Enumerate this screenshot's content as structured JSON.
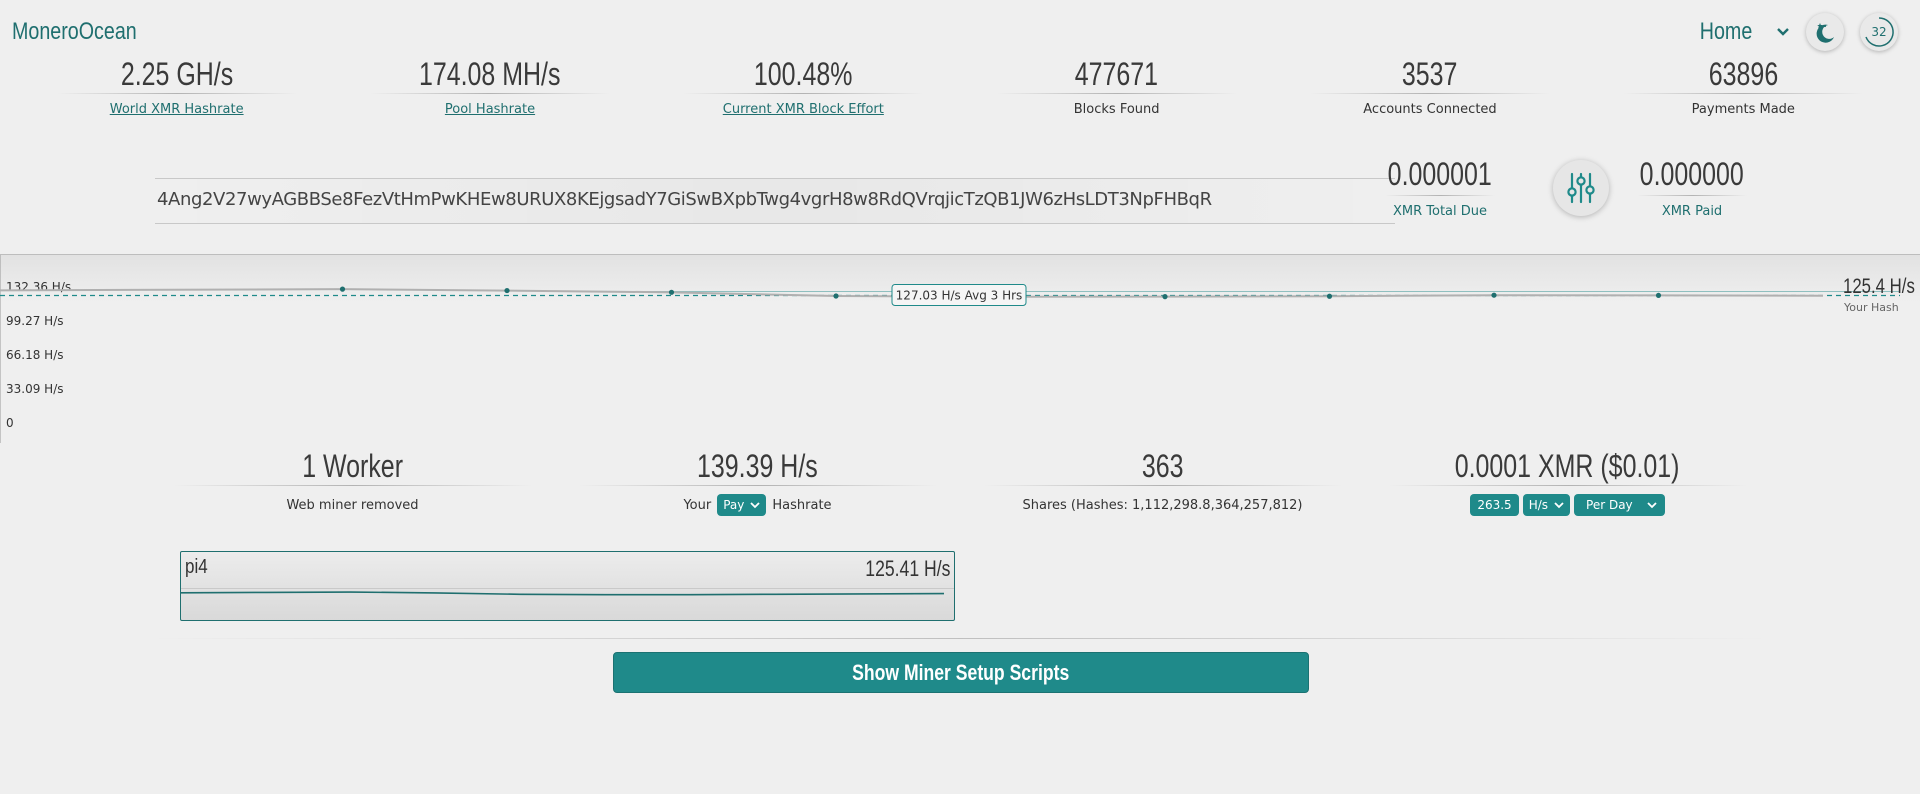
{
  "header": {
    "brand": "MoneroOcean",
    "nav_label": "Home",
    "counter": "32"
  },
  "stats": [
    {
      "value": "2.25 GH/s",
      "label": "World XMR Hashrate"
    },
    {
      "value": "174.08 MH/s",
      "label": "Pool Hashrate"
    },
    {
      "value": "100.48%",
      "label": "Current XMR Block Effort"
    },
    {
      "value": "477671",
      "label": "Blocks Found"
    },
    {
      "value": "3537",
      "label": "Accounts Connected"
    },
    {
      "value": "63896",
      "label": "Payments Made"
    }
  ],
  "account": {
    "address": "4Ang2V27wyAGBBSe8FezVtHmPwKHEw8URUX8KEjgsadY7GiSwBXpbTwg4vgrH8w8RdQVrqjicTzQB1JW6zHsLDT3NpFHBqR",
    "total_due": "0.000001",
    "total_due_label": "XMR Total Due",
    "paid": "0.000000",
    "paid_label": "XMR Paid"
  },
  "chart_data": {
    "type": "line",
    "y_ticks": [
      "132.36 H/s",
      "99.27 H/s",
      "66.18 H/s",
      "33.09 H/s",
      "0"
    ],
    "ylim": [
      0,
      132.36
    ],
    "values": [
      132,
      133.2,
      131.8,
      130.1,
      126.5,
      125.8,
      125.9,
      126.3,
      127.3,
      127.1,
      126.8
    ],
    "average_value": 127.03,
    "average_label": "127.03 H/s Avg 3 Hrs",
    "current_value": "125.4 H/s",
    "current_label": "Your Hash"
  },
  "worker_stats": {
    "workers": "1 Worker",
    "workers_label": "Web miner removed",
    "hashrate": "139.39 H/s",
    "hashrate_prefix": "Your",
    "hashrate_mode": "Pay",
    "hashrate_suffix": "Hashrate",
    "shares": "363",
    "shares_label": "Shares (Hashes: 1,112,298.8,364,257,812)",
    "earnings": "0.0001 XMR ($0.01)",
    "calc_value": "263.5",
    "calc_unit": "H/s",
    "calc_period": "Per Day"
  },
  "worker": {
    "name": "pi4",
    "rate": "125.41 H/s",
    "spark": [
      0.62,
      0.6,
      0.58,
      0.63,
      0.7,
      0.72,
      0.72,
      0.7,
      0.68,
      0.66
    ]
  },
  "setup_button": "Show Miner Setup Scripts"
}
